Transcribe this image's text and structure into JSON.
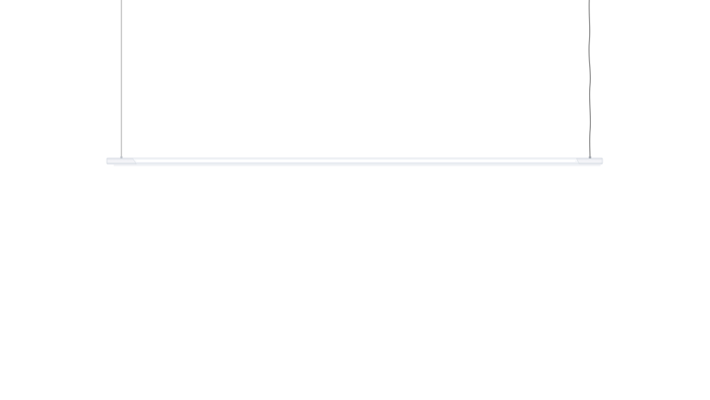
{
  "image": {
    "subject": "linear-pendant-lamp",
    "background_color": "#ffffff",
    "fixture_body_color": "#f3f5f8",
    "fixture_diffuser_color": "#fbfcfe",
    "end_cap_color": "#eceff3",
    "left_cable_color": "#9a9a9a",
    "right_cable_color": "#6f6f6f"
  }
}
